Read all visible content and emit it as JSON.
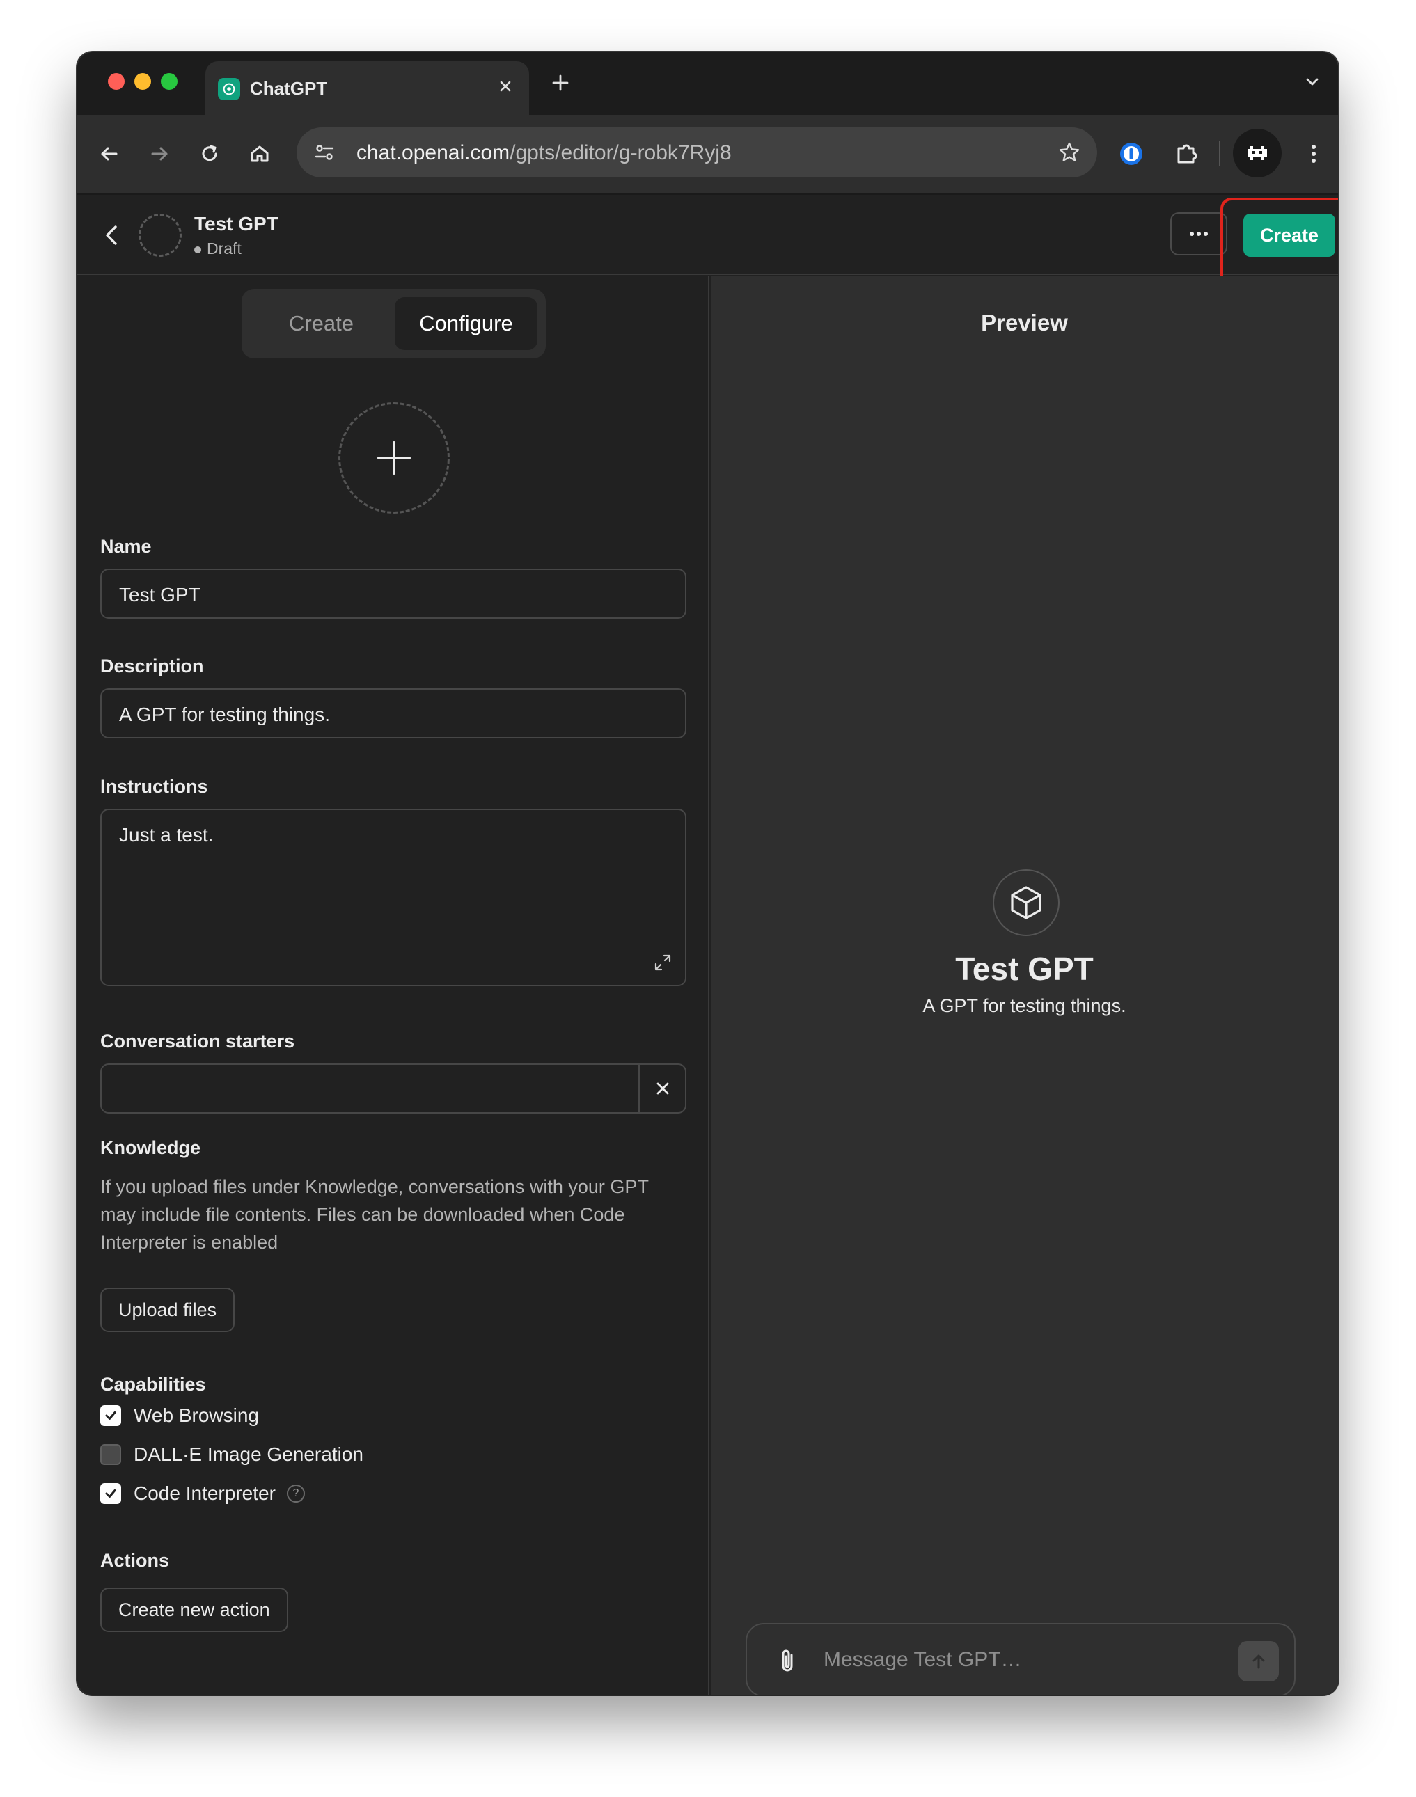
{
  "browser": {
    "tab_title": "ChatGPT",
    "url_host": "chat.openai.com",
    "url_path": "/gpts/editor/g-robk7Ryj8"
  },
  "header": {
    "title": "Test GPT",
    "status": "Draft",
    "create_label": "Create",
    "accent_color": "#10a37f",
    "highlight_color": "#e0241c"
  },
  "tabs": {
    "create": "Create",
    "configure": "Configure"
  },
  "form": {
    "name_label": "Name",
    "name_value": "Test GPT",
    "description_label": "Description",
    "description_value": "A GPT for testing things.",
    "instructions_label": "Instructions",
    "instructions_value": "Just a test.",
    "starters_label": "Conversation starters",
    "starters_value": "",
    "knowledge_label": "Knowledge",
    "knowledge_note": "If you upload files under Knowledge, conversations with your GPT may include file contents. Files can be downloaded when Code Interpreter is enabled",
    "upload_label": "Upload files",
    "capabilities_label": "Capabilities",
    "capabilities": [
      {
        "label": "Web Browsing",
        "checked": true
      },
      {
        "label": "DALL·E Image Generation",
        "checked": false
      },
      {
        "label": "Code Interpreter",
        "checked": true
      }
    ],
    "help_glyph": "?",
    "actions_label": "Actions",
    "new_action_label": "Create new action"
  },
  "preview": {
    "title": "Preview",
    "gpt_name": "Test GPT",
    "gpt_description": "A GPT for testing things.",
    "message_placeholder": "Message Test GPT…"
  }
}
